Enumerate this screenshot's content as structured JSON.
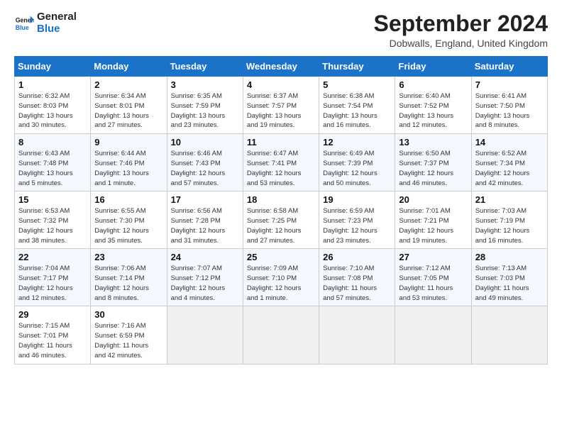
{
  "logo": {
    "line1": "General",
    "line2": "Blue"
  },
  "title": "September 2024",
  "location": "Dobwalls, England, United Kingdom",
  "days_header": [
    "Sunday",
    "Monday",
    "Tuesday",
    "Wednesday",
    "Thursday",
    "Friday",
    "Saturday"
  ],
  "weeks": [
    [
      {
        "day": "1",
        "info": "Sunrise: 6:32 AM\nSunset: 8:03 PM\nDaylight: 13 hours\nand 30 minutes."
      },
      {
        "day": "2",
        "info": "Sunrise: 6:34 AM\nSunset: 8:01 PM\nDaylight: 13 hours\nand 27 minutes."
      },
      {
        "day": "3",
        "info": "Sunrise: 6:35 AM\nSunset: 7:59 PM\nDaylight: 13 hours\nand 23 minutes."
      },
      {
        "day": "4",
        "info": "Sunrise: 6:37 AM\nSunset: 7:57 PM\nDaylight: 13 hours\nand 19 minutes."
      },
      {
        "day": "5",
        "info": "Sunrise: 6:38 AM\nSunset: 7:54 PM\nDaylight: 13 hours\nand 16 minutes."
      },
      {
        "day": "6",
        "info": "Sunrise: 6:40 AM\nSunset: 7:52 PM\nDaylight: 13 hours\nand 12 minutes."
      },
      {
        "day": "7",
        "info": "Sunrise: 6:41 AM\nSunset: 7:50 PM\nDaylight: 13 hours\nand 8 minutes."
      }
    ],
    [
      {
        "day": "8",
        "info": "Sunrise: 6:43 AM\nSunset: 7:48 PM\nDaylight: 13 hours\nand 5 minutes."
      },
      {
        "day": "9",
        "info": "Sunrise: 6:44 AM\nSunset: 7:46 PM\nDaylight: 13 hours\nand 1 minute."
      },
      {
        "day": "10",
        "info": "Sunrise: 6:46 AM\nSunset: 7:43 PM\nDaylight: 12 hours\nand 57 minutes."
      },
      {
        "day": "11",
        "info": "Sunrise: 6:47 AM\nSunset: 7:41 PM\nDaylight: 12 hours\nand 53 minutes."
      },
      {
        "day": "12",
        "info": "Sunrise: 6:49 AM\nSunset: 7:39 PM\nDaylight: 12 hours\nand 50 minutes."
      },
      {
        "day": "13",
        "info": "Sunrise: 6:50 AM\nSunset: 7:37 PM\nDaylight: 12 hours\nand 46 minutes."
      },
      {
        "day": "14",
        "info": "Sunrise: 6:52 AM\nSunset: 7:34 PM\nDaylight: 12 hours\nand 42 minutes."
      }
    ],
    [
      {
        "day": "15",
        "info": "Sunrise: 6:53 AM\nSunset: 7:32 PM\nDaylight: 12 hours\nand 38 minutes."
      },
      {
        "day": "16",
        "info": "Sunrise: 6:55 AM\nSunset: 7:30 PM\nDaylight: 12 hours\nand 35 minutes."
      },
      {
        "day": "17",
        "info": "Sunrise: 6:56 AM\nSunset: 7:28 PM\nDaylight: 12 hours\nand 31 minutes."
      },
      {
        "day": "18",
        "info": "Sunrise: 6:58 AM\nSunset: 7:25 PM\nDaylight: 12 hours\nand 27 minutes."
      },
      {
        "day": "19",
        "info": "Sunrise: 6:59 AM\nSunset: 7:23 PM\nDaylight: 12 hours\nand 23 minutes."
      },
      {
        "day": "20",
        "info": "Sunrise: 7:01 AM\nSunset: 7:21 PM\nDaylight: 12 hours\nand 19 minutes."
      },
      {
        "day": "21",
        "info": "Sunrise: 7:03 AM\nSunset: 7:19 PM\nDaylight: 12 hours\nand 16 minutes."
      }
    ],
    [
      {
        "day": "22",
        "info": "Sunrise: 7:04 AM\nSunset: 7:17 PM\nDaylight: 12 hours\nand 12 minutes."
      },
      {
        "day": "23",
        "info": "Sunrise: 7:06 AM\nSunset: 7:14 PM\nDaylight: 12 hours\nand 8 minutes."
      },
      {
        "day": "24",
        "info": "Sunrise: 7:07 AM\nSunset: 7:12 PM\nDaylight: 12 hours\nand 4 minutes."
      },
      {
        "day": "25",
        "info": "Sunrise: 7:09 AM\nSunset: 7:10 PM\nDaylight: 12 hours\nand 1 minute."
      },
      {
        "day": "26",
        "info": "Sunrise: 7:10 AM\nSunset: 7:08 PM\nDaylight: 11 hours\nand 57 minutes."
      },
      {
        "day": "27",
        "info": "Sunrise: 7:12 AM\nSunset: 7:05 PM\nDaylight: 11 hours\nand 53 minutes."
      },
      {
        "day": "28",
        "info": "Sunrise: 7:13 AM\nSunset: 7:03 PM\nDaylight: 11 hours\nand 49 minutes."
      }
    ],
    [
      {
        "day": "29",
        "info": "Sunrise: 7:15 AM\nSunset: 7:01 PM\nDaylight: 11 hours\nand 46 minutes."
      },
      {
        "day": "30",
        "info": "Sunrise: 7:16 AM\nSunset: 6:59 PM\nDaylight: 11 hours\nand 42 minutes."
      },
      {
        "day": "",
        "info": ""
      },
      {
        "day": "",
        "info": ""
      },
      {
        "day": "",
        "info": ""
      },
      {
        "day": "",
        "info": ""
      },
      {
        "day": "",
        "info": ""
      }
    ]
  ]
}
